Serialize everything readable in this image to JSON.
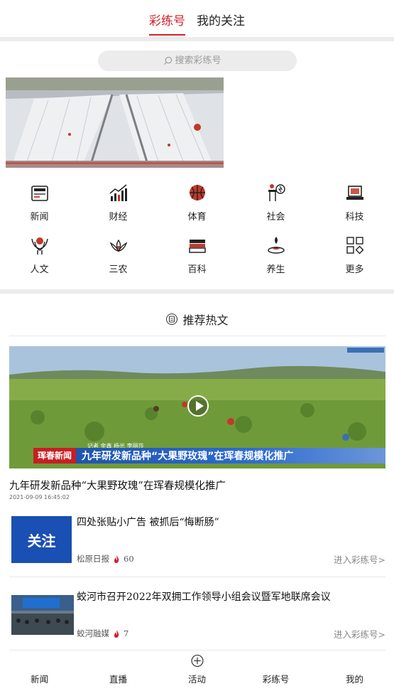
{
  "top_tabs": [
    "彩练号",
    "我的关注"
  ],
  "search": {
    "placeholder": "搜索彩练号"
  },
  "categories": [
    {
      "label": "新闻",
      "icon": "newspaper-icon"
    },
    {
      "label": "财经",
      "icon": "bar-chart-icon"
    },
    {
      "label": "体育",
      "icon": "basketball-icon"
    },
    {
      "label": "社会",
      "icon": "society-icon"
    },
    {
      "label": "科技",
      "icon": "laptop-icon"
    },
    {
      "label": "人文",
      "icon": "culture-icon"
    },
    {
      "label": "三农",
      "icon": "lotus-icon"
    },
    {
      "label": "百科",
      "icon": "books-icon"
    },
    {
      "label": "养生",
      "icon": "wellness-icon"
    },
    {
      "label": "更多",
      "icon": "grid-icon"
    }
  ],
  "hot": {
    "title": "推荐热文"
  },
  "video": {
    "caption_tag": "珲春新闻",
    "caption_sub": "记者 金鑫 杨光 李丽莎",
    "caption_text": "九年研发新品种“大果野玫瑰”在珲春规模化推广",
    "title": "九年研发新品种“大果野玫瑰”在珲春规模化推广",
    "date": "2021-09-09 16:45:02"
  },
  "items": [
    {
      "title": "四处张贴小广告 被抓后“悔断肠”",
      "thumb_text": "关注",
      "source": "松原日报",
      "heat": "60",
      "enter": "进入彩练号>"
    },
    {
      "title": "蛟河市召开2022年双拥工作领导小组会议暨军地联席会议",
      "source": "蛟河融媒",
      "heat": "7",
      "enter": "进入彩练号>"
    }
  ],
  "bottom_nav": [
    "新闻",
    "直播",
    "活动",
    "彩练号",
    "我的"
  ],
  "colors": {
    "accent": "#d0202a",
    "separator": "#ececec"
  }
}
